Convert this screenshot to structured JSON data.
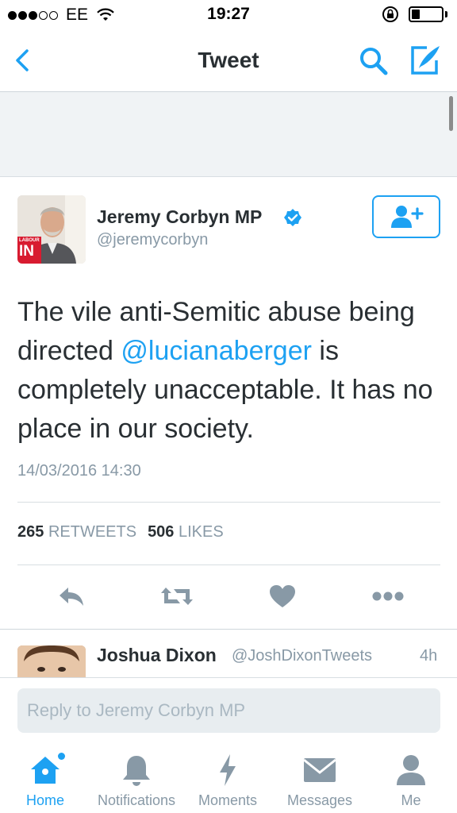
{
  "status_bar": {
    "carrier": "EE",
    "time": "19:27"
  },
  "nav": {
    "title": "Tweet",
    "accent_color": "#1da1f2"
  },
  "tweet": {
    "author_name": "Jeremy Corbyn MP",
    "author_handle": "@jeremycorbyn",
    "verified": true,
    "avatar_badge_text": "IN",
    "avatar_badge_top": "LABOUR",
    "text_before_mention": "The vile anti-Semitic abuse being directed ",
    "mention": "@lucianaberger",
    "text_after_mention": " is completely unacceptable. It has no place in our society.",
    "timestamp": "14/03/2016 14:30",
    "retweets_count": "265",
    "retweets_label": "RETWEETS",
    "likes_count": "506",
    "likes_label": "LIKES"
  },
  "reply_preview": {
    "name": "Joshua Dixon",
    "handle": "@JoshDixonTweets",
    "age": "4h"
  },
  "composer": {
    "placeholder": "Reply to Jeremy Corbyn MP"
  },
  "tabs": [
    {
      "label": "Home",
      "icon": "home-icon",
      "active": true
    },
    {
      "label": "Notifications",
      "icon": "bell-icon"
    },
    {
      "label": "Moments",
      "icon": "lightning-icon"
    },
    {
      "label": "Messages",
      "icon": "envelope-icon"
    },
    {
      "label": "Me",
      "icon": "person-icon"
    }
  ]
}
